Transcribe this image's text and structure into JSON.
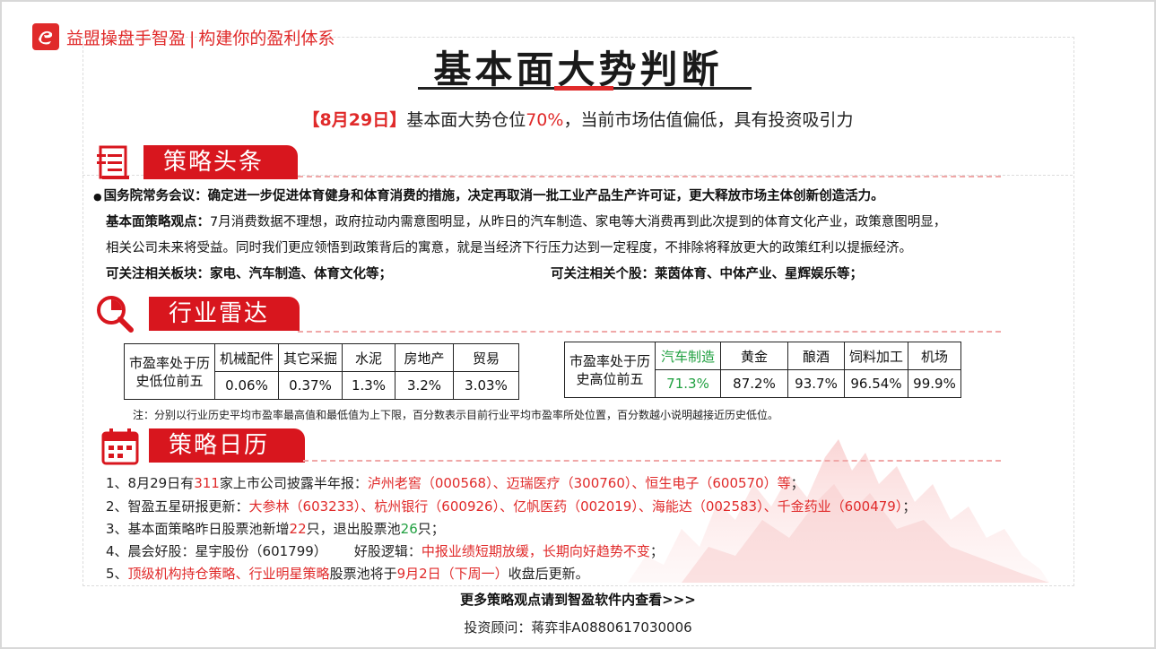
{
  "brand": {
    "name": "益盟操盘手智盈",
    "divider": "|",
    "slogan": "构建你的盈利体系"
  },
  "title": "基本面大势判断",
  "headline": {
    "date": "【8月29日】",
    "text1": "基本面大势仓位",
    "position": "70%",
    "text2": "，当前市场估值偏低，具有投资吸引力"
  },
  "sections": {
    "strategy_headline": "策略头条",
    "industry_radar": "行业雷达",
    "strategy_calendar": "策略日历"
  },
  "strategy": {
    "news_bullet": "●",
    "news": "国务院常务会议：确定进一步促进体育健身和体育消费的措施，决定再取消一批工业产品生产许可证，更大释放市场主体创新创造活力。",
    "view_label": "基本面策略观点：",
    "view_line1": "7月消费数据不理想，政府拉动内需意图明显，从昨日的汽车制造、家电等大消费再到此次提到的体育文化产业，政策意图明显，",
    "view_line2": "相关公司未来将受益。同时我们更应领悟到政策背后的寓意，就是当经济下行压力达到一定程度，不排除将释放更大的政策红利以提振经济。",
    "sectors_label": "可关注相关板块：",
    "sectors": "家电、汽车制造、体育文化等；",
    "stocks_label": "可关注相关个股：",
    "stocks": "莱茵体育、中体产业、星辉娱乐等；"
  },
  "radar": {
    "low": {
      "label_line1": "市盈率处于历",
      "label_line2": "史低位前五",
      "items": [
        {
          "name": "机械配件",
          "value": "0.06%"
        },
        {
          "name": "其它采掘",
          "value": "0.37%"
        },
        {
          "name": "水泥",
          "value": "1.3%"
        },
        {
          "name": "房地产",
          "value": "3.2%"
        },
        {
          "name": "贸易",
          "value": "3.03%"
        }
      ]
    },
    "high": {
      "label_line1": "市盈率处于历",
      "label_line2": "史高位前五",
      "items": [
        {
          "name": "汽车制造",
          "value": "71.3%"
        },
        {
          "name": "黄金",
          "value": "87.2%"
        },
        {
          "name": "酿酒",
          "value": "93.7%"
        },
        {
          "name": "饲料加工",
          "value": "96.54%"
        },
        {
          "name": "机场",
          "value": "99.9%"
        }
      ]
    },
    "note": "注：分别以行业历史平均市盈率最高值和最低值为上下限，百分数表示目前行业平均市盈率所处位置，百分数越小说明越接近历史低位。"
  },
  "calendar": {
    "item1": {
      "prefix": "1、8月29日有",
      "count": "311",
      "mid": "家上市公司披露半年报：",
      "companies": "泸州老窖（000568）、迈瑞医疗（300760）、恒生电子（600570）等",
      "suffix": "；"
    },
    "item2": {
      "prefix": "2、智盈五星研报更新：",
      "companies": "大参林（603233）、杭州银行（600926）、亿帆医药（002019）、海能达（002583）、千金药业（600479）",
      "suffix": "；"
    },
    "item3": {
      "prefix": "3、基本面策略昨日股票池新增",
      "added": "22",
      "mid": "只，退出股票池",
      "removed": "26",
      "suffix": "只；"
    },
    "item4": {
      "prefix": "4、晨会好股：星宇股份（601799）",
      "logic_label": "好股逻辑：",
      "logic": "中报业绩短期放缓，长期向好趋势不变",
      "suffix": "；"
    },
    "item5": {
      "prefix": "5、",
      "pools": "顶级机构持仓策略、行业明星策略",
      "mid": "股票池将于",
      "date": "9月2日（下周一）",
      "suffix": "收盘后更新。"
    }
  },
  "footer": {
    "more": "更多策略观点请到智盈软件内查看>>>",
    "advisor": "投资顾问：蒋弈非A0880617030006"
  },
  "colors": {
    "accent": "#e02a2a",
    "section_bg": "#d8161e",
    "positive": "#20a040"
  },
  "icons": [
    "logo-icon",
    "document-icon",
    "magnifier-chart-icon",
    "calendar-icon"
  ]
}
